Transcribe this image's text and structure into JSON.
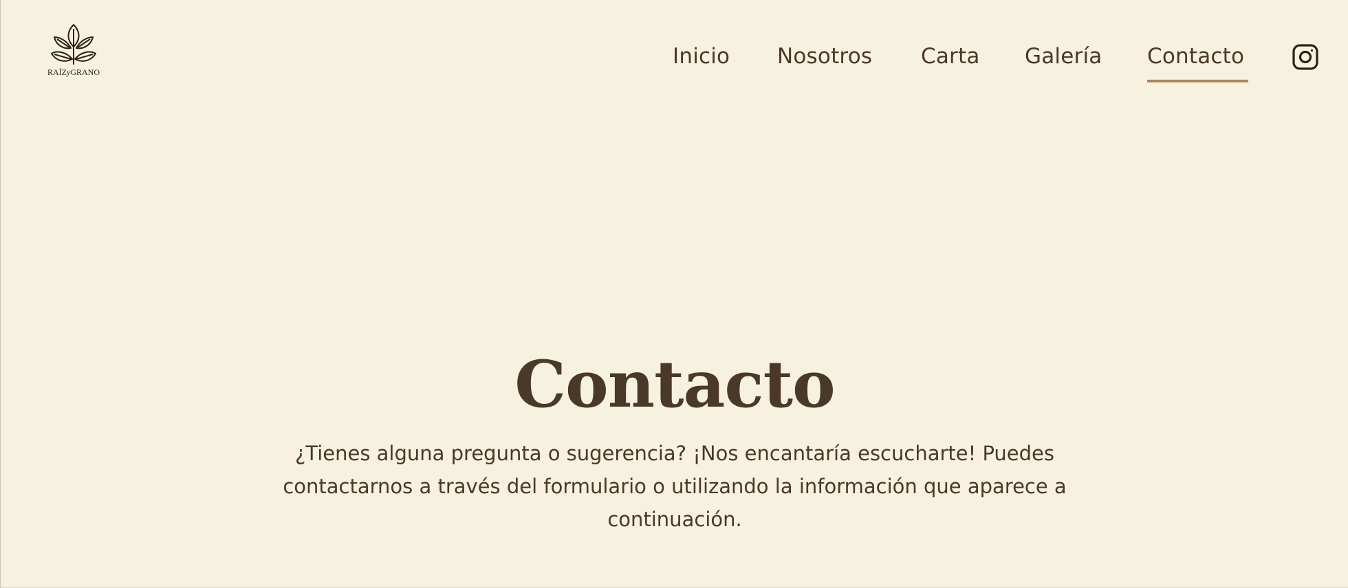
{
  "brand": {
    "name_left": "RAÍZ",
    "name_mid": "y",
    "name_right": "GRANO",
    "logo_icon": "leaf-sprout-icon"
  },
  "nav": {
    "items": [
      {
        "label": "Inicio"
      },
      {
        "label": "Nosotros"
      },
      {
        "label": "Carta"
      },
      {
        "label": "Galería"
      },
      {
        "label": "Contacto"
      }
    ],
    "active": "Contacto",
    "social_icon": "instagram-icon"
  },
  "hero": {
    "title": "Contacto",
    "text": "¿Tienes alguna pregunta o sugerencia? ¡Nos encantaría escucharte! Puedes contactarnos a través del formulario o utilizando la información que aparece a continuación."
  },
  "colors": {
    "background": "#f7f1df",
    "text": "#4a3828",
    "accent": "#a8845f"
  }
}
